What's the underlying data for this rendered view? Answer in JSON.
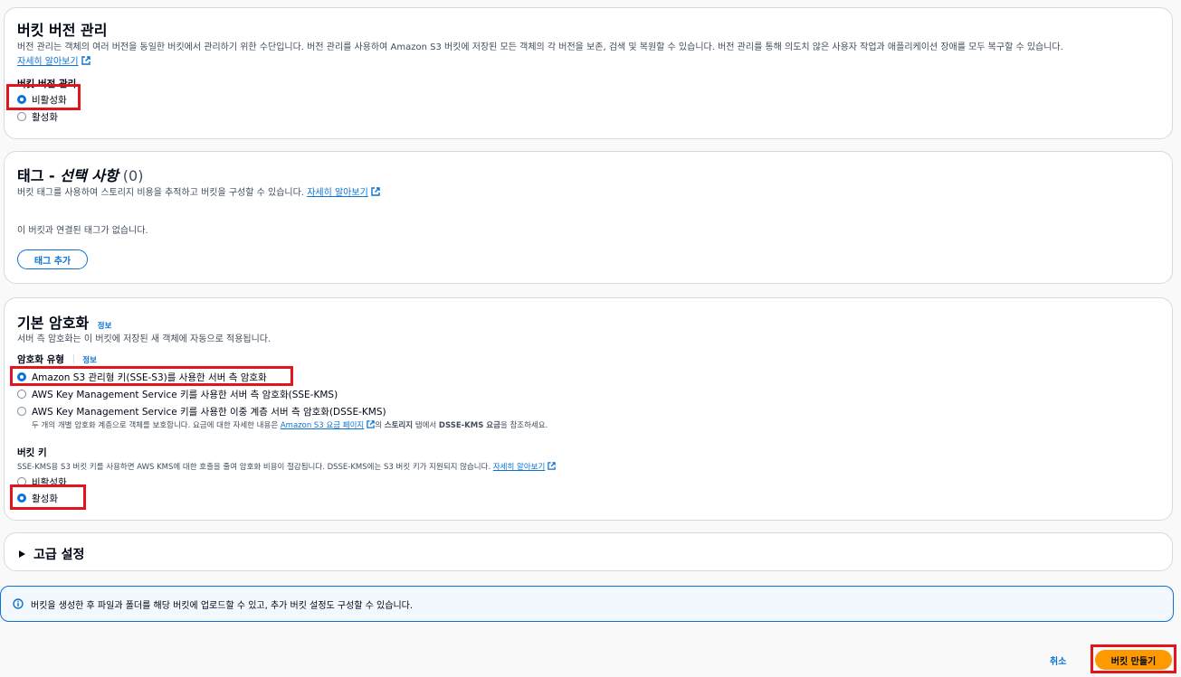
{
  "versioning": {
    "title": "버킷 버전 관리",
    "description": "버전 관리는 객체의 여러 버전을 동일한 버킷에서 관리하기 위한 수단입니다. 버전 관리를 사용하여 Amazon S3 버킷에 저장된 모든 객체의 각 버전을 보존, 검색 및 복원할 수 있습니다. 버전 관리를 통해 의도치 않은 사용자 작업과 애플리케이션 장애를 모두 복구할 수 있습니다.",
    "learn_more": "자세히 알아보기",
    "group_label": "버킷 버전 관리",
    "options": [
      "비활성화",
      "활성화"
    ],
    "selected": "비활성화"
  },
  "tags": {
    "title": "태그 - ",
    "title_italic": "선택 사항",
    "count": " (0)",
    "description": "버킷 태그를 사용하여 스토리지 비용을 추적하고 버킷을 구성할 수 있습니다.",
    "learn_more": "자세히 알아보기",
    "empty_text": "이 버킷과 연결된 태그가 없습니다.",
    "add_button": "태그 추가"
  },
  "encryption": {
    "title": "기본 암호화",
    "info": "정보",
    "description": "서버 측 암호화는 이 버킷에 저장된 새 객체에 자동으로 적용됩니다.",
    "type_label": "암호화 유형",
    "type_info": "정보",
    "options": [
      "Amazon S3 관리형 키(SSE-S3)를 사용한 서버 측 암호화",
      "AWS Key Management Service 키를 사용한 서버 측 암호화(SSE-KMS)",
      "AWS Key Management Service 키를 사용한 이중 계층 서버 측 암호화(DSSE-KMS)"
    ],
    "selected": "Amazon S3 관리형 키(SSE-S3)를 사용한 서버 측 암호화",
    "dsse_desc_prefix": "두 개의 개별 암호화 계층으로 객체를 보호합니다. 요금에 대한 자세한 내용은 ",
    "dsse_desc_link": "Amazon S3 요금 페이지",
    "dsse_desc_mid": "의 ",
    "dsse_desc_bold1": "스토리지",
    "dsse_desc_mid2": " 탭에서 ",
    "dsse_desc_bold2": "DSSE-KMS 요금",
    "dsse_desc_suffix": "을 참조하세요.",
    "bucket_key_label": "버킷 키",
    "bucket_key_desc": "SSE-KMS용 S3 버킷 키를 사용하면 AWS KMS에 대한 호출을 줄여 암호화 비용이 절감됩니다. DSSE-KMS에는 S3 버킷 키가 지원되지 않습니다.",
    "bucket_key_learn_more": "자세히 알아보기",
    "bucket_key_options": [
      "비활성화",
      "활성화"
    ],
    "bucket_key_selected": "활성화"
  },
  "advanced": {
    "title": "고급 설정"
  },
  "alert": {
    "text": "버킷을 생성한 후 파일과 폴더를 해당 버킷에 업로드할 수 있고, 추가 버킷 설정도 구성할 수 있습니다."
  },
  "footer": {
    "cancel": "취소",
    "create": "버킷 만들기"
  },
  "colors": {
    "link": "#0972d3",
    "primary_button": "#ff9900",
    "highlight_box": "#e3141b",
    "alert_bg": "#f2f8fd"
  }
}
